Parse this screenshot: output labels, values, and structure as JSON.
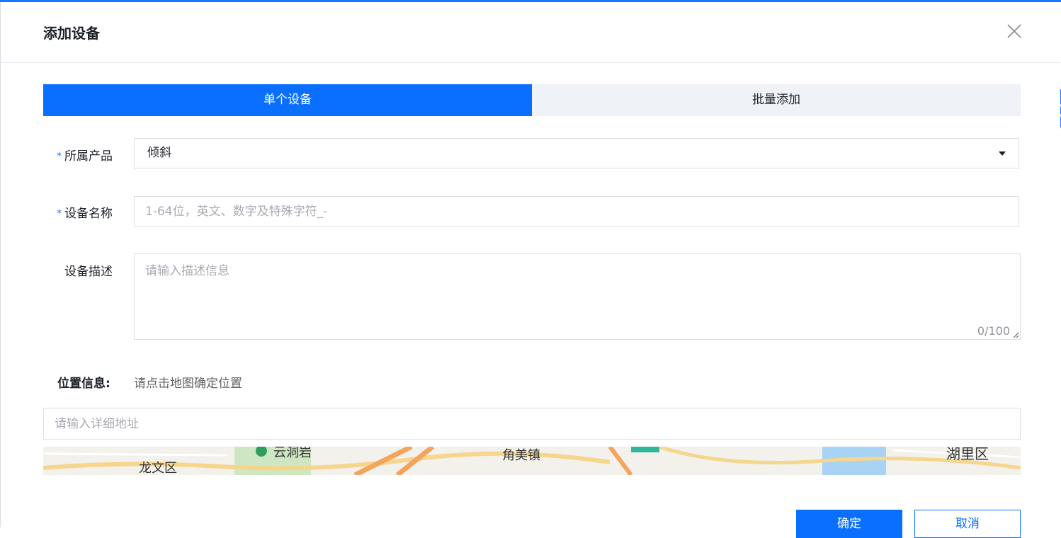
{
  "dialog": {
    "title": "添加设备",
    "close_icon": "close-icon"
  },
  "tabs": [
    {
      "label": "单个设备",
      "active": true
    },
    {
      "label": "批量添加",
      "active": false
    }
  ],
  "form": {
    "required_mark": "*",
    "product": {
      "label": "所属产品",
      "value": "倾斜"
    },
    "device_name": {
      "label": "设备名称",
      "placeholder": "1-64位，英文、数字及特殊字符_-"
    },
    "description": {
      "label": "设备描述",
      "placeholder": "请输入描述信息",
      "counter": "0/100"
    },
    "location": {
      "label": "位置信息:",
      "hint": "请点击地图确定位置"
    },
    "address": {
      "placeholder": "请输入详细地址"
    }
  },
  "map": {
    "labels": [
      "龙文区",
      "云洞岩",
      "角美镇",
      "湖里区"
    ]
  },
  "buttons": {
    "confirm": "确定",
    "cancel": "取消"
  },
  "colors": {
    "primary": "#0a6fff",
    "tab_inactive_bg": "#eff2f7",
    "required": "#1677ff"
  }
}
